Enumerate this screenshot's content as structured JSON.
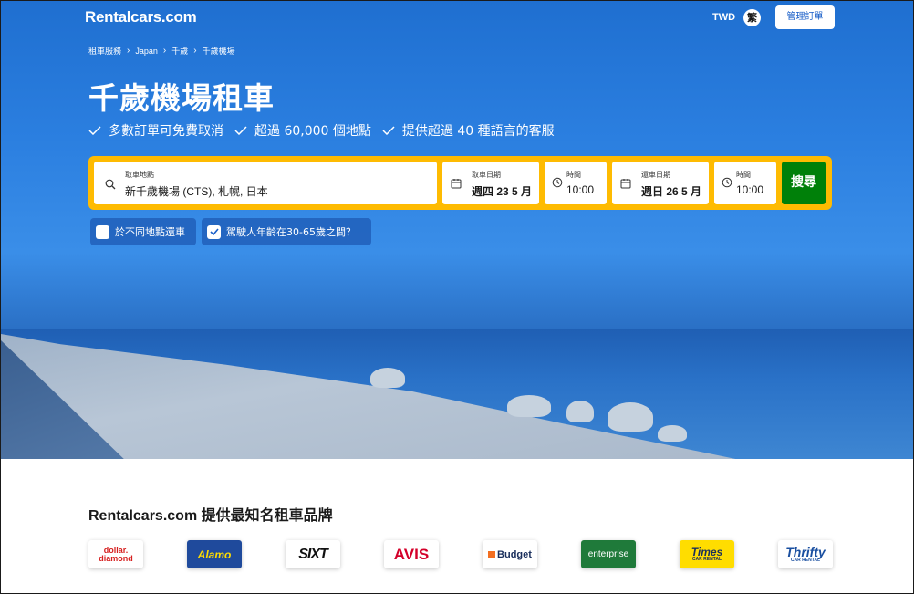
{
  "header": {
    "logo": "Rentalcars.com",
    "currency": "TWD",
    "language": "繁",
    "manage_booking": "管理訂單"
  },
  "breadcrumb": [
    "租車服務",
    "Japan",
    "千歲",
    "千歲機場"
  ],
  "hero": {
    "title": "千歲機場租車",
    "features": [
      "多數訂單可免費取消",
      "超過 60,000 個地點",
      "提供超過 40 種語言的客服"
    ]
  },
  "search": {
    "pickup_location_label": "取車地點",
    "pickup_location_value": "新千歲機場 (CTS), 札幌, 日本",
    "pickup_date_label": "取車日期",
    "pickup_date_value": "週四 23 5 月",
    "pickup_time_label": "時間",
    "pickup_time_value": "10:00",
    "dropoff_date_label": "還車日期",
    "dropoff_date_value": "週日 26 5 月",
    "dropoff_time_label": "時間",
    "dropoff_time_value": "10:00",
    "search_button": "搜尋"
  },
  "options": {
    "different_dropoff": "於不同地點還車",
    "different_dropoff_checked": false,
    "driver_age": "駕駛人年齡在30-65歲之間？",
    "driver_age_checked": true
  },
  "brands": {
    "title": "Rentalcars.com 提供最知名租車品牌",
    "items": [
      {
        "name": "dollar. diamond",
        "line1": "dollar.",
        "line2": "diamond",
        "color": "#d6201f"
      },
      {
        "name": "Alamo",
        "color": "#ffffff",
        "bg": "#1f4a9c"
      },
      {
        "name": "SIXT",
        "color": "#111111",
        "bg": "#ffffff"
      },
      {
        "name": "AVIS",
        "color": "#d4002a",
        "bg": "#ffffff"
      },
      {
        "name": "Budget",
        "color": "#1a2f5c",
        "bg": "#ffffff"
      },
      {
        "name": "enterprise",
        "color": "#ffffff",
        "bg": "#1f7a3a"
      },
      {
        "name": "Times",
        "sub": "CAR RENTAL",
        "color": "#1a2f5c",
        "bg": "#ffdd00"
      },
      {
        "name": "Thrifty",
        "sub": "CAR RENTAL",
        "color": "#1a4fa0",
        "bg": "#ffffff"
      }
    ]
  },
  "colors": {
    "search_bar": "#febb02",
    "search_button": "#008009",
    "link_blue": "#1a5fc8"
  }
}
